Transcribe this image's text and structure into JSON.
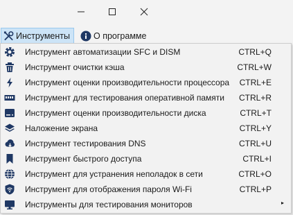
{
  "colors": {
    "icon": "#1f3864",
    "highlight": "#cce4f7",
    "accent": "#1565c0"
  },
  "window_controls": {
    "minimize": "minimize-icon",
    "maximize": "maximize-icon",
    "close": "close-icon"
  },
  "menubar": {
    "tools_label": "Инструменты",
    "tools_icon": "tools-icon",
    "about_label": "О программе",
    "about_icon": "info-icon"
  },
  "menu": {
    "items": [
      {
        "label": "Инструмент автоматизации SFC и DISM",
        "shortcut": "CTRL+Q",
        "icon": "gear-icon"
      },
      {
        "label": "Инструмент очистки кэша",
        "shortcut": "CTRL+W",
        "icon": "trash-icon"
      },
      {
        "label": "Инструмент оценки производительности процессора",
        "shortcut": "CTRL+E",
        "icon": "lightning-icon"
      },
      {
        "label": "Инструмент для тестирования оперативной памяти",
        "shortcut": "CTRL+R",
        "icon": "memory-icon"
      },
      {
        "label": "Инструмент оценки производительности диска",
        "shortcut": "CTRL+T",
        "icon": "disk-icon"
      },
      {
        "label": "Наложение экрана",
        "shortcut": "CTRL+Y",
        "icon": "layers-icon"
      },
      {
        "label": "Инструмент тестирования DNS",
        "shortcut": "CTRL+U",
        "icon": "cloud-icon"
      },
      {
        "label": "Инструмент быстрого доступа",
        "shortcut": "CTRL+I",
        "icon": "bookmark-icon"
      },
      {
        "label": "Инструмент для устранения неполадок в сети",
        "shortcut": "CTRL+O",
        "icon": "globe-icon"
      },
      {
        "label": "Инструмент для отображения пароля Wi-Fi",
        "shortcut": "CTRL+P",
        "icon": "wifi-shield-icon"
      },
      {
        "label": "Инструменты для тестирования мониторов",
        "shortcut": "",
        "icon": "monitor-icon",
        "submenu_arrow": "▸"
      }
    ]
  }
}
